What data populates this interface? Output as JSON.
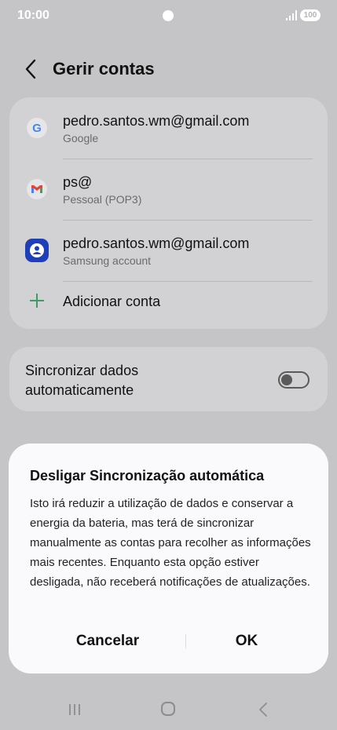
{
  "status_bar": {
    "time": "10:00",
    "battery": "100"
  },
  "header": {
    "title": "Gerir contas"
  },
  "accounts": [
    {
      "email": "pedro.santos.wm@gmail.com",
      "type": "Google",
      "icon": "google-icon"
    },
    {
      "email": "ps@",
      "type": "Pessoal (POP3)",
      "icon": "gmail-icon"
    },
    {
      "email": "pedro.santos.wm@gmail.com",
      "type": "Samsung account",
      "icon": "samsung-account-icon"
    }
  ],
  "add_account": {
    "label": "Adicionar conta"
  },
  "sync": {
    "label": "Sincronizar dados automaticamente",
    "enabled": false
  },
  "dialog": {
    "title": "Desligar Sincronização automática",
    "body": "Isto irá reduzir a utilização de dados e conservar a energia da bateria, mas terá de sincronizar manualmente as contas para recolher as informações mais recentes. Enquanto esta opção estiver desligada, não receberá notificações de atualizações.",
    "cancel_label": "Cancelar",
    "ok_label": "OK"
  },
  "colors": {
    "overlay_bg": "#c5c5c7",
    "card_bg": "#d2d2d4",
    "dialog_bg": "#fafafc",
    "accent_green": "#3e9b64"
  }
}
